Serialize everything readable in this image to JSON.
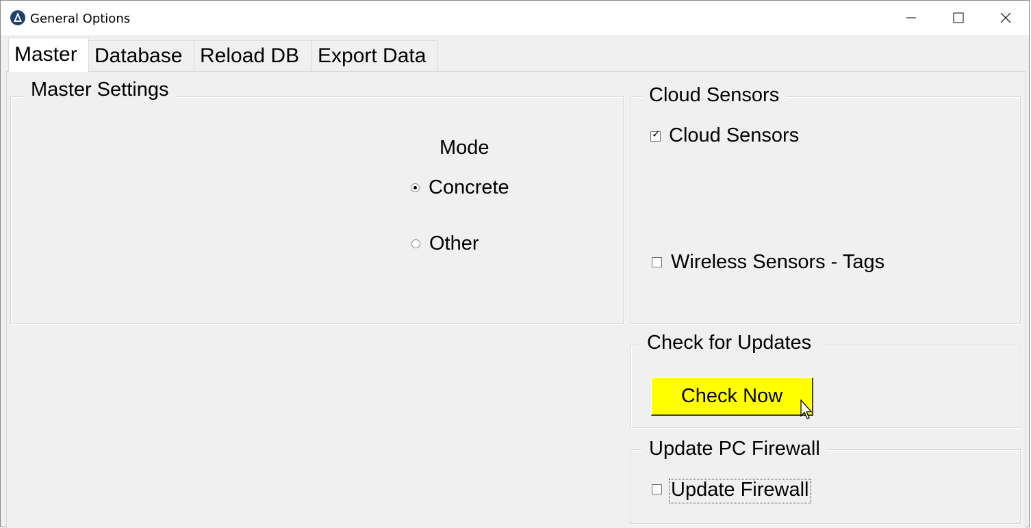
{
  "window": {
    "title": "General Options",
    "icon": "app-logo-icon",
    "controls": [
      "minimize-icon",
      "maximize-icon",
      "close-icon"
    ]
  },
  "tabs": [
    {
      "label": "Master",
      "active": true
    },
    {
      "label": "Database",
      "active": false
    },
    {
      "label": "Reload DB",
      "active": false
    },
    {
      "label": "Export Data",
      "active": false
    }
  ],
  "master_settings": {
    "title": "Master Settings",
    "mode_label": "Mode",
    "options": [
      {
        "label": "Concrete",
        "selected": true
      },
      {
        "label": "Other",
        "selected": false
      }
    ]
  },
  "cloud_sensors": {
    "title": "Cloud Sensors",
    "items": [
      {
        "label": "Cloud Sensors",
        "checked": true
      },
      {
        "label": "Wireless Sensors - Tags",
        "checked": false
      }
    ]
  },
  "updates": {
    "title": "Check for Updates",
    "button_label": "Check Now",
    "button_color": "#ffff00"
  },
  "firewall": {
    "title": "Update PC Firewall",
    "checkbox_label": "Update Firewall",
    "checked": false
  }
}
